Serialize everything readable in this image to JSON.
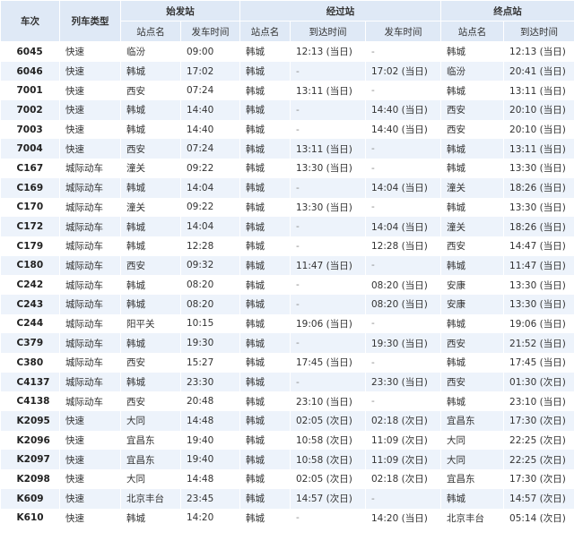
{
  "headers": {
    "train_no": "车次",
    "train_type": "列车类型",
    "origin_group": "始发站",
    "via_group": "经过站",
    "terminal_group": "终点站",
    "station_name": "站点名",
    "depart_time": "发车时间",
    "arrive_time": "到达时间"
  },
  "rows": [
    {
      "no": "6045",
      "type": "快速",
      "o_st": "临汾",
      "o_dep": "09:00",
      "v_st": "韩城",
      "v_arr": "12:13 (当日)",
      "v_dep": "-",
      "t_st": "韩城",
      "t_arr": "12:13 (当日)"
    },
    {
      "no": "6046",
      "type": "快速",
      "o_st": "韩城",
      "o_dep": "17:02",
      "v_st": "韩城",
      "v_arr": "-",
      "v_dep": "17:02 (当日)",
      "t_st": "临汾",
      "t_arr": "20:41 (当日)"
    },
    {
      "no": "7001",
      "type": "快速",
      "o_st": "西安",
      "o_dep": "07:24",
      "v_st": "韩城",
      "v_arr": "13:11 (当日)",
      "v_dep": "-",
      "t_st": "韩城",
      "t_arr": "13:11 (当日)"
    },
    {
      "no": "7002",
      "type": "快速",
      "o_st": "韩城",
      "o_dep": "14:40",
      "v_st": "韩城",
      "v_arr": "-",
      "v_dep": "14:40 (当日)",
      "t_st": "西安",
      "t_arr": "20:10 (当日)"
    },
    {
      "no": "7003",
      "type": "快速",
      "o_st": "韩城",
      "o_dep": "14:40",
      "v_st": "韩城",
      "v_arr": "-",
      "v_dep": "14:40 (当日)",
      "t_st": "西安",
      "t_arr": "20:10 (当日)"
    },
    {
      "no": "7004",
      "type": "快速",
      "o_st": "西安",
      "o_dep": "07:24",
      "v_st": "韩城",
      "v_arr": "13:11 (当日)",
      "v_dep": "-",
      "t_st": "韩城",
      "t_arr": "13:11 (当日)"
    },
    {
      "no": "C167",
      "type": "城际动车",
      "o_st": "潼关",
      "o_dep": "09:22",
      "v_st": "韩城",
      "v_arr": "13:30 (当日)",
      "v_dep": "-",
      "t_st": "韩城",
      "t_arr": "13:30 (当日)"
    },
    {
      "no": "C169",
      "type": "城际动车",
      "o_st": "韩城",
      "o_dep": "14:04",
      "v_st": "韩城",
      "v_arr": "-",
      "v_dep": "14:04 (当日)",
      "t_st": "潼关",
      "t_arr": "18:26 (当日)"
    },
    {
      "no": "C170",
      "type": "城际动车",
      "o_st": "潼关",
      "o_dep": "09:22",
      "v_st": "韩城",
      "v_arr": "13:30 (当日)",
      "v_dep": "-",
      "t_st": "韩城",
      "t_arr": "13:30 (当日)"
    },
    {
      "no": "C172",
      "type": "城际动车",
      "o_st": "韩城",
      "o_dep": "14:04",
      "v_st": "韩城",
      "v_arr": "-",
      "v_dep": "14:04 (当日)",
      "t_st": "潼关",
      "t_arr": "18:26 (当日)"
    },
    {
      "no": "C179",
      "type": "城际动车",
      "o_st": "韩城",
      "o_dep": "12:28",
      "v_st": "韩城",
      "v_arr": "-",
      "v_dep": "12:28 (当日)",
      "t_st": "西安",
      "t_arr": "14:47 (当日)"
    },
    {
      "no": "C180",
      "type": "城际动车",
      "o_st": "西安",
      "o_dep": "09:32",
      "v_st": "韩城",
      "v_arr": "11:47 (当日)",
      "v_dep": "-",
      "t_st": "韩城",
      "t_arr": "11:47 (当日)"
    },
    {
      "no": "C242",
      "type": "城际动车",
      "o_st": "韩城",
      "o_dep": "08:20",
      "v_st": "韩城",
      "v_arr": "-",
      "v_dep": "08:20 (当日)",
      "t_st": "安康",
      "t_arr": "13:30 (当日)"
    },
    {
      "no": "C243",
      "type": "城际动车",
      "o_st": "韩城",
      "o_dep": "08:20",
      "v_st": "韩城",
      "v_arr": "-",
      "v_dep": "08:20 (当日)",
      "t_st": "安康",
      "t_arr": "13:30 (当日)"
    },
    {
      "no": "C244",
      "type": "城际动车",
      "o_st": "阳平关",
      "o_dep": "10:15",
      "v_st": "韩城",
      "v_arr": "19:06 (当日)",
      "v_dep": "-",
      "t_st": "韩城",
      "t_arr": "19:06 (当日)"
    },
    {
      "no": "C379",
      "type": "城际动车",
      "o_st": "韩城",
      "o_dep": "19:30",
      "v_st": "韩城",
      "v_arr": "-",
      "v_dep": "19:30 (当日)",
      "t_st": "西安",
      "t_arr": "21:52 (当日)"
    },
    {
      "no": "C380",
      "type": "城际动车",
      "o_st": "西安",
      "o_dep": "15:27",
      "v_st": "韩城",
      "v_arr": "17:45 (当日)",
      "v_dep": "-",
      "t_st": "韩城",
      "t_arr": "17:45 (当日)"
    },
    {
      "no": "C4137",
      "type": "城际动车",
      "o_st": "韩城",
      "o_dep": "23:30",
      "v_st": "韩城",
      "v_arr": "-",
      "v_dep": "23:30 (当日)",
      "t_st": "西安",
      "t_arr": "01:30 (次日)"
    },
    {
      "no": "C4138",
      "type": "城际动车",
      "o_st": "西安",
      "o_dep": "20:48",
      "v_st": "韩城",
      "v_arr": "23:10 (当日)",
      "v_dep": "-",
      "t_st": "韩城",
      "t_arr": "23:10 (当日)"
    },
    {
      "no": "K2095",
      "type": "快速",
      "o_st": "大同",
      "o_dep": "14:48",
      "v_st": "韩城",
      "v_arr": "02:05 (次日)",
      "v_dep": "02:18 (次日)",
      "t_st": "宜昌东",
      "t_arr": "17:30 (次日)"
    },
    {
      "no": "K2096",
      "type": "快速",
      "o_st": "宜昌东",
      "o_dep": "19:40",
      "v_st": "韩城",
      "v_arr": "10:58 (次日)",
      "v_dep": "11:09 (次日)",
      "t_st": "大同",
      "t_arr": "22:25 (次日)"
    },
    {
      "no": "K2097",
      "type": "快速",
      "o_st": "宜昌东",
      "o_dep": "19:40",
      "v_st": "韩城",
      "v_arr": "10:58 (次日)",
      "v_dep": "11:09 (次日)",
      "t_st": "大同",
      "t_arr": "22:25 (次日)"
    },
    {
      "no": "K2098",
      "type": "快速",
      "o_st": "大同",
      "o_dep": "14:48",
      "v_st": "韩城",
      "v_arr": "02:05 (次日)",
      "v_dep": "02:18 (次日)",
      "t_st": "宜昌东",
      "t_arr": "17:30 (次日)"
    },
    {
      "no": "K609",
      "type": "快速",
      "o_st": "北京丰台",
      "o_dep": "23:45",
      "v_st": "韩城",
      "v_arr": "14:57 (次日)",
      "v_dep": "-",
      "t_st": "韩城",
      "t_arr": "14:57 (次日)"
    },
    {
      "no": "K610",
      "type": "快速",
      "o_st": "韩城",
      "o_dep": "14:20",
      "v_st": "韩城",
      "v_arr": "-",
      "v_dep": "14:20 (当日)",
      "t_st": "北京丰台",
      "t_arr": "05:14 (次日)"
    }
  ]
}
